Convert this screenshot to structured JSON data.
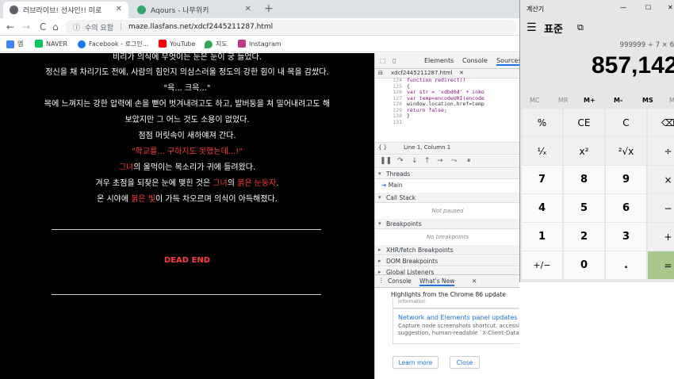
{
  "browser": {
    "tabs": [
      {
        "title": "러브라이브! 선샤인!! 미로",
        "active": true
      },
      {
        "title": "Aqours - 나무위키",
        "active": false
      }
    ],
    "new_tab": "+",
    "nav": {
      "back": "←",
      "forward": "→",
      "reload": "C",
      "home": "⌂"
    },
    "security_label": "수의 요함",
    "url": "maze.llasfans.net/xdcf2445211287.html",
    "bookmarks": [
      "앱",
      "NAVER",
      "Facebook - 로그인...",
      "YouTube",
      "지도",
      "Instagram"
    ]
  },
  "page": {
    "lines": [
      [
        {
          "t": "비리가 의식에 무엇이는 눈은 눈이 궁 들었다.",
          "c": "w"
        }
      ],
      [
        {
          "t": "정신을 채 차리기도 전에, 사람의 힘인지 의심스러울 정도의 강한 힘이 내 목을 감쌌다.",
          "c": "w"
        }
      ],
      [
        {
          "t": "\"윽... 크윽...\"",
          "c": "w"
        }
      ],
      [
        {
          "t": "목에 느껴지는 강한 압력에 손을 뻗어 벗겨내려고도 하고, 발버둥을 쳐 밀어내려고도 해",
          "c": "w"
        }
      ],
      [
        {
          "t": "보았지만 그 어느 것도 소용이 없었다.",
          "c": "w"
        }
      ],
      [
        {
          "t": "점점 머릿속이 새하얘져 간다.",
          "c": "w"
        }
      ],
      [
        {
          "t": "\"학교를... 구하지도 못했는데...!\"",
          "c": "r"
        }
      ],
      [
        {
          "t": "그녀",
          "c": "r"
        },
        {
          "t": "의 울먹이는 목소리가 귀에 들려왔다.",
          "c": "w"
        }
      ],
      [
        {
          "t": "겨우 초점을 되찾은 눈에 맺힌 것은 ",
          "c": "w"
        },
        {
          "t": "그녀",
          "c": "r"
        },
        {
          "t": "의 ",
          "c": "w"
        },
        {
          "t": "붉은 눈동자",
          "c": "r"
        },
        {
          "t": ".",
          "c": "w"
        }
      ],
      [
        {
          "t": "온 시야에 ",
          "c": "w"
        },
        {
          "t": "붉은 빛",
          "c": "r"
        },
        {
          "t": "이 가득 차오르며 의식이 아득해졌다.",
          "c": "w"
        }
      ]
    ],
    "ending": "DEAD END"
  },
  "devtools": {
    "tabs": [
      "Elements",
      "Console",
      "Sources"
    ],
    "file": "xdcf2445211287.html",
    "code": [
      {
        "n": "124",
        "s": "function redirect()"
      },
      {
        "n": "125",
        "s": "{"
      },
      {
        "n": "126",
        "s": "  var str = 'xdbd0d' + inko"
      },
      {
        "n": "127",
        "s": "  var temp=encodeURI(encode"
      },
      {
        "n": "128",
        "s": "  window.location.href=temp"
      },
      {
        "n": "129",
        "s": "  return false;"
      },
      {
        "n": "130",
        "s": "}"
      },
      {
        "n": "131",
        "s": ""
      }
    ],
    "position": "Line 1, Column 1",
    "threads": "Threads",
    "thread_main": "Main",
    "call_stack": "Call Stack",
    "not_paused": "Not paused",
    "breakpoints": "Breakpoints",
    "no_breakpoints": "No breakpoints",
    "xhr": "XHR/fetch Breakpoints",
    "dom": "DOM Breakpoints",
    "global": "Global Listeners",
    "drawer_tabs": [
      "Console",
      "What's New"
    ],
    "whats_new_title": "Highlights from the Chrome 86 update",
    "info_cut": "information",
    "update_title": "Network and Elements panel updates",
    "update_desc": "Capture node screenshots shortcut, accessible color suggestion, human-readable `X-Client-Data`, and more",
    "learn_more": "Learn more",
    "close": "Close"
  },
  "calculator": {
    "app_title": "계산기",
    "mode": "표준",
    "window_controls": [
      "—",
      "☐",
      "✕"
    ],
    "expression": "999999 ÷ 7 × 6",
    "display": "857,142",
    "memory": [
      "MC",
      "MR",
      "M+",
      "M-",
      "MS",
      "M"
    ],
    "keys": [
      [
        "%",
        "CE",
        "C",
        "⌫"
      ],
      [
        "¹⁄ₓ",
        "x²",
        "²√x",
        "÷"
      ],
      [
        "7",
        "8",
        "9",
        "×"
      ],
      [
        "4",
        "5",
        "6",
        "−"
      ],
      [
        "1",
        "2",
        "3",
        "+"
      ],
      [
        "+/−",
        "0",
        ".",
        "="
      ]
    ]
  },
  "colors": {
    "page_bg": "#000000",
    "story_red": "#ff3b3b",
    "calc_equals": "#a9c88e",
    "link_blue": "#1a73e8"
  }
}
